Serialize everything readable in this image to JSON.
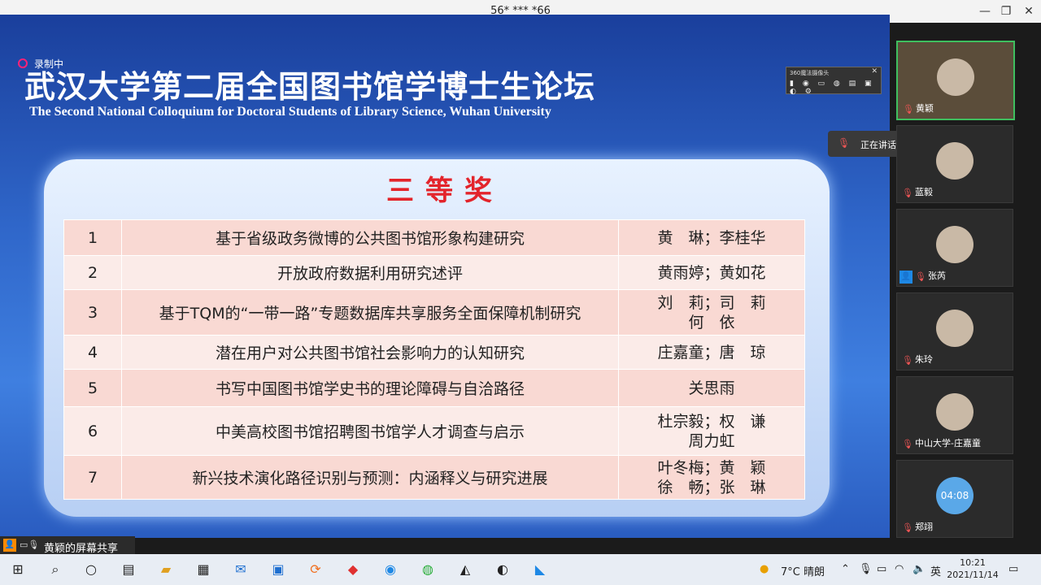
{
  "window": {
    "title": "56* *** *66",
    "minimize": "—",
    "restore": "❐",
    "close": "✕"
  },
  "slide": {
    "recording": "录制中",
    "title_cn": "武汉大学第二届全国图书馆学博士生论坛",
    "title_en": "The Second National Colloquium for Doctoral Students of Library Science, Wuhan University",
    "award": "三等奖",
    "rows": [
      {
        "no": "1",
        "title": "基于省级政务微博的公共图书馆形象构建研究",
        "authors": [
          "黄　琳；李桂华"
        ]
      },
      {
        "no": "2",
        "title": "开放政府数据利用研究述评",
        "authors": [
          "黄雨婷；黄如花"
        ]
      },
      {
        "no": "3",
        "title": "基于TQM的“一带一路”专题数据库共享服务全面保障机制研究",
        "authors": [
          "刘　莉；司　莉",
          "何　依"
        ]
      },
      {
        "no": "4",
        "title": "潜在用户对公共图书馆社会影响力的认知研究",
        "authors": [
          "庄嘉童；唐　琼"
        ]
      },
      {
        "no": "5",
        "title": "书写中国图书馆学史书的理论障碍与自洽路径",
        "authors": [
          "关思雨"
        ]
      },
      {
        "no": "6",
        "title": "中美高校图书馆招聘图书馆学人才调查与启示",
        "authors": [
          "杜宗毅；权　谦",
          "周力虹"
        ]
      },
      {
        "no": "7",
        "title": "新兴技术演化路径识别与预测：内涵释义与研究进展",
        "authors": [
          "叶冬梅；黄　颖",
          "徐　畅；张　琳"
        ]
      }
    ]
  },
  "mini_toolbar": {
    "title": "360魔法摄像头",
    "close": "✕"
  },
  "speaking": {
    "text": "正在讲话: 黄颖; 青墨;"
  },
  "participants": [
    {
      "name": "黄颖",
      "active": true
    },
    {
      "name": "蓝毅"
    },
    {
      "name": "张芮",
      "host": true
    },
    {
      "name": "朱玲"
    },
    {
      "name": "中山大学-庄嘉童"
    },
    {
      "name": "郑翊",
      "timer": "04:08"
    }
  ],
  "share": {
    "label": "黄颖的屏幕共享"
  },
  "taskbar": {
    "weather": "7°C 晴朗",
    "ime": "英",
    "time": "10:21",
    "date": "2021/11/14"
  },
  "colors": {
    "accent_red": "#e3242b",
    "slide_blue": "#2f66c9",
    "row_pink": "#f9d9d3"
  }
}
